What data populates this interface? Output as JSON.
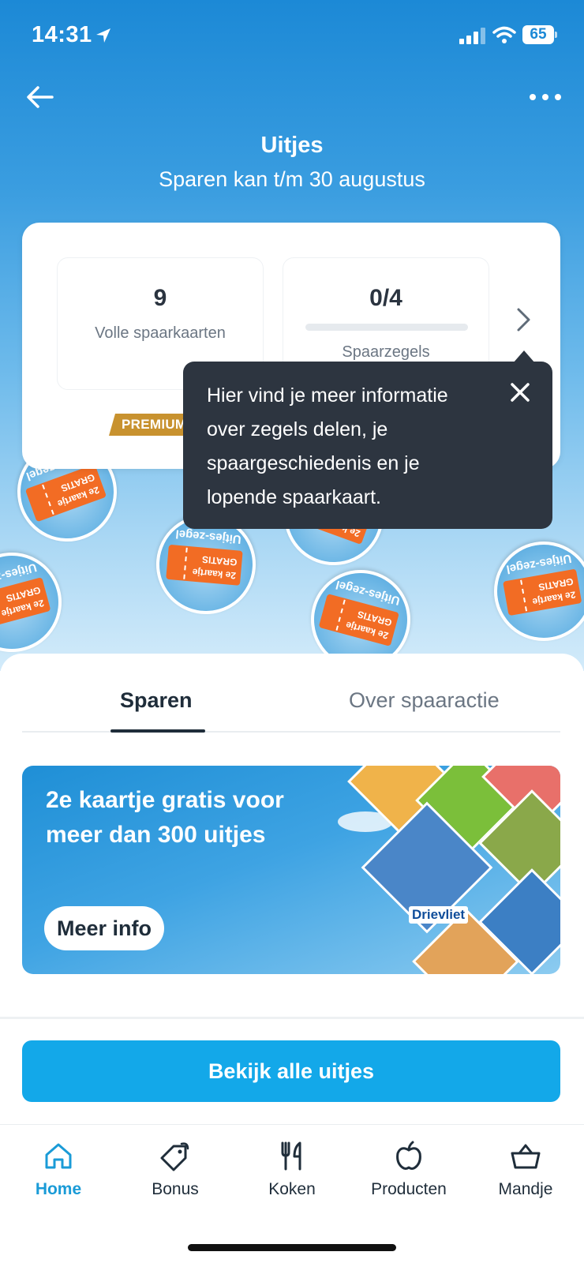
{
  "status_bar": {
    "time": "14:31",
    "battery": "65"
  },
  "header": {
    "title": "Uitjes",
    "subtitle": "Sparen kan t/m 30 augustus"
  },
  "stats": {
    "full_cards": {
      "value": "9",
      "label": "Volle spaarkaarten"
    },
    "stamps": {
      "value": "0/4",
      "label": "Spaarzegels",
      "progress": 0
    },
    "badge": "PREMIUM"
  },
  "tooltip": {
    "text": "Hier vind je meer informatie over zegels delen, je spaargeschiedenis en je lopende spaarkaart."
  },
  "stamp_coin": {
    "ticket_text": "2e kaartje GRATIS",
    "ring_text": "Uitjes-zegel"
  },
  "tabs": [
    {
      "label": "Sparen",
      "active": true
    },
    {
      "label": "Over spaaractie",
      "active": false
    }
  ],
  "banner": {
    "title": "2e kaartje gratis voor meer dan 300 uitjes",
    "button": "Meer info",
    "image_caption": "Drievliet"
  },
  "cta": {
    "label": "Bekijk alle uitjes"
  },
  "nav": [
    {
      "label": "Home",
      "icon": "home-icon",
      "active": true
    },
    {
      "label": "Bonus",
      "icon": "tag-icon",
      "active": false
    },
    {
      "label": "Koken",
      "icon": "cutlery-icon",
      "active": false
    },
    {
      "label": "Producten",
      "icon": "apple-icon",
      "active": false
    },
    {
      "label": "Mandje",
      "icon": "basket-icon",
      "active": false
    }
  ],
  "colors": {
    "brand_blue": "#13a8e9",
    "active_nav": "#1a9bd7",
    "tooltip_bg": "#2d3540",
    "premium": "#c8922f",
    "ticket_orange": "#f26c24"
  }
}
